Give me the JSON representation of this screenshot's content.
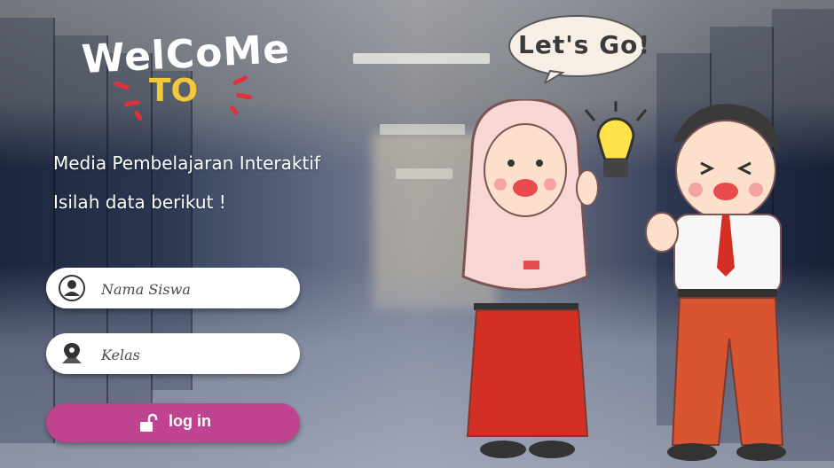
{
  "header": {
    "welcome": "WelCoMe",
    "to": "TO",
    "subtitle1": "Media Pembelajaran Interaktif",
    "subtitle2": "Isilah data berikut !"
  },
  "form": {
    "name_placeholder": "Nama Siswa",
    "class_placeholder": "Kelas",
    "name_icon": "user-icon",
    "class_icon": "map-pin-icon",
    "login_label": "log in",
    "login_icon": "unlock-icon"
  },
  "illustration": {
    "speech_bubble": "Let's Go!",
    "bulb_icon": "lightbulb-icon"
  },
  "colors": {
    "login_button": "#c0438f",
    "to_text": "#f3c93a",
    "accent_red": "#e0303a"
  }
}
